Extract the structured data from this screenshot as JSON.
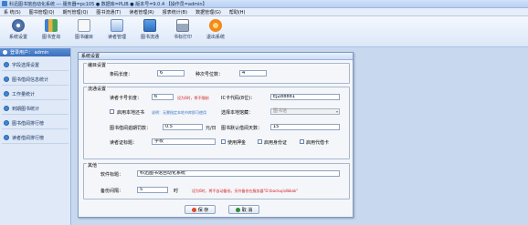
{
  "titlebar": {
    "text": "科迅图书馆自动化系统 --- 服务器=pc105 ● 数据库=PLIB ● 版本号=9.0.4   【操作员=admin】"
  },
  "menu": [
    "系 统(S)",
    "图书管理(Q)",
    "期刊管理(Q)",
    "图书流通(T)",
    "读者管理(R)",
    "报表统计(B)",
    "数据管理(G)",
    "帮助(H)"
  ],
  "toolbar": [
    "系统设置",
    "图书查询",
    "图书编目",
    "读者管理",
    "图书流通",
    "书标打印",
    "退出系统"
  ],
  "sidebar": {
    "user_label": "登录用户： admin",
    "items": [
      "字段选择设置",
      "图书借阅信息统计",
      "工作量统计",
      "到期图书统计",
      "图书借阅排行榜",
      "读者借阅排行榜"
    ]
  },
  "dialog": {
    "title": "系统设置",
    "group_catalog": {
      "title": "编目设置",
      "barcode_label": "条码长度：",
      "barcode_value": "6",
      "seq_label": "种次号位数：",
      "seq_value": "4"
    },
    "group_circ": {
      "title": "流通设置",
      "card_len_label": "读者卡号长度：",
      "card_len_value": "6",
      "card_len_hint": "设为0时，将不限制",
      "ic_label": "IC卡代码(8位)：",
      "ic_value": "EJZ88881",
      "local_check_label": "启用本地还书",
      "local_check_hint": "说明：无需指定本地书库即可使用",
      "local_lib_label": "选择本地馆藏：",
      "local_lib_value": "图书馆",
      "overdue_label": "图书借阅逾期罚款：",
      "overdue_value": "0.5",
      "overdue_unit": "元/日",
      "default_days_label": "图书默认借阅天数：",
      "default_days_value": "15",
      "card_type_label": "读者证标题：",
      "card_type_value": "学校",
      "chk_deposit": "使用押金",
      "chk_id": "启用身份证",
      "chk_proxy": "启用代借卡"
    },
    "group_other": {
      "title": "其他",
      "software_label": "软件标题：",
      "software_value": "科迅图书馆自动化系统",
      "backup_label": "备份间隔：",
      "backup_value": "5",
      "backup_unit": "时",
      "backup_hint": "设为0时，将不自动备份。另外备份在服务器\"D:\\backup\\dbbak\""
    },
    "save_button": "保 存",
    "cancel_button": "取 消"
  },
  "colors": {
    "accent": "#3a6fbe",
    "hint": "#d32020",
    "link": "#3a73c4"
  }
}
